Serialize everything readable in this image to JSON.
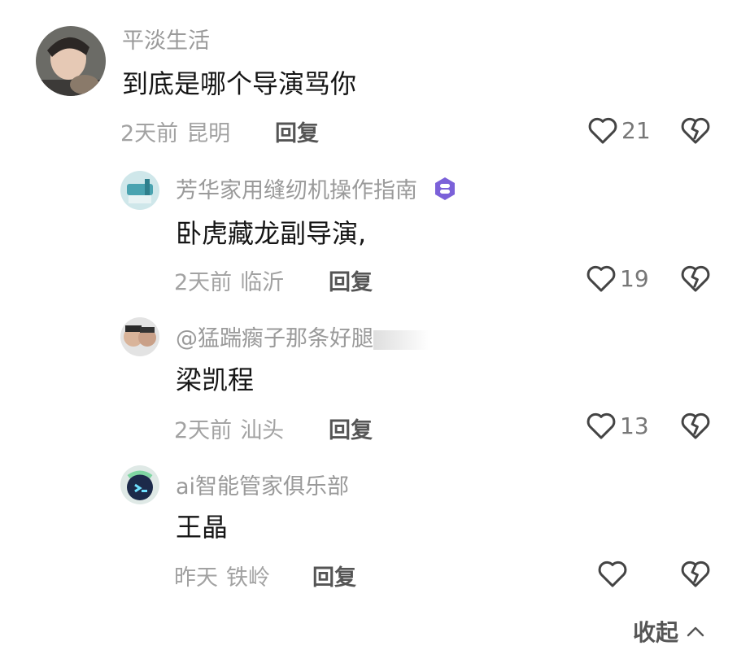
{
  "comments": [
    {
      "username": "平淡生活",
      "text": "到底是哪个导演骂你",
      "time": "2天前",
      "location": "昆明",
      "reply_label": "回复",
      "likes": "21"
    },
    {
      "username": "芳华家用缝纫机操作指南",
      "text": "卧虎藏龙副导演,",
      "time": "2天前",
      "location": "临沂",
      "reply_label": "回复",
      "likes": "19"
    },
    {
      "username": "@猛踹瘸子那条好腿",
      "text": "梁凯程",
      "time": "2天前",
      "location": "汕头",
      "reply_label": "回复",
      "likes": "13"
    },
    {
      "username": "ai智能管家俱乐部",
      "text": "王晶",
      "time": "昨天",
      "location": "铁岭",
      "reply_label": "回复",
      "likes": ""
    }
  ],
  "collapse_label": "收起",
  "colors": {
    "text": "#161616",
    "secondary": "#9a9a9a",
    "badge": "#7b61d9"
  },
  "icons": [
    "heart-outline-icon",
    "broken-heart-icon",
    "verified-badge-icon",
    "chevron-up-icon"
  ]
}
